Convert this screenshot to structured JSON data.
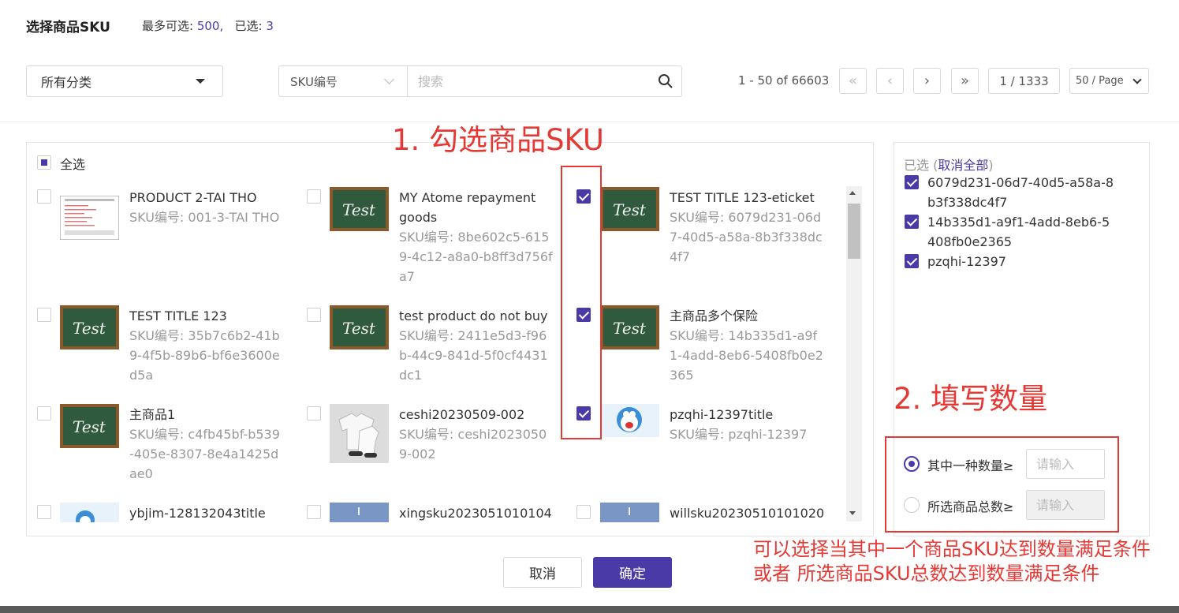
{
  "header": {
    "title": "选择商品SKU",
    "max_label": "最多可选: ",
    "max_value": "500,",
    "selected_label": "已选: ",
    "selected_value": "3"
  },
  "toolbar": {
    "category": "所有分类",
    "search_type": "SKU编号",
    "search_placeholder": "搜索"
  },
  "pagination": {
    "range": "1 - 50 of 66603",
    "first": "«",
    "prev": "‹",
    "next": "›",
    "last": "»",
    "current": "1 / 1333",
    "page_size": "50 / Page"
  },
  "select_all": "全选",
  "products": [
    {
      "name": "PRODUCT 2-TAI THO",
      "sku": "SKU编号: 001-3-TAI THO",
      "thumb": "document",
      "checked": false
    },
    {
      "name": "MY Atome repayment goods",
      "sku": "SKU编号: 8be602c5-6159-4c12-a8a0-b8ff3d756fa7",
      "thumb": "chalkboard",
      "checked": false
    },
    {
      "name": "TEST TITLE 123-eticket",
      "sku": "SKU编号: 6079d231-06d7-40d5-a58a-8b3f338dc4f7",
      "thumb": "chalkboard",
      "checked": true
    },
    {
      "name": "TEST TITLE 123",
      "sku": "SKU编号: 35b7c6b2-41b9-4f5b-89b6-bf6e3600ed5a",
      "thumb": "chalkboard",
      "checked": false
    },
    {
      "name": "test product do not buy",
      "sku": "SKU编号: 2411e5d3-f96b-44c9-841d-5f0cf4431dc1",
      "thumb": "chalkboard",
      "checked": true
    },
    {
      "name": "主商品多个保险",
      "sku": "SKU编号: 14b335d1-a9f1-4add-8eb6-5408fb0e2365",
      "thumb": "chalkboard",
      "checked": false
    },
    {
      "name": "主商品1",
      "sku": "SKU编号: c4fb45bf-b539-405e-8307-8e4a1425dae0",
      "thumb": "chalkboard",
      "checked": false
    },
    {
      "name": "ceshi20230509-002",
      "sku": "SKU编号: ceshi20230509-002",
      "thumb": "clothes",
      "checked": true
    },
    {
      "name": "pzqhi-12397title",
      "sku": "SKU编号: pzqhi-12397",
      "thumb": "cartoon",
      "checked": false
    },
    {
      "name": "ybjim-128132043title",
      "sku": "",
      "thumb": "cartoon",
      "checked": false
    },
    {
      "name": "xingsku2023051010104",
      "sku": "",
      "thumb": "sky",
      "checked": false
    },
    {
      "name": "willsku20230510101020",
      "sku": "",
      "thumb": "sky",
      "checked": false
    }
  ],
  "selected_panel": {
    "label": "已选 (",
    "clear_all": "取消全部",
    "close_paren": ")",
    "items": [
      "6079d231-06d7-40d5-a58a-8b3f338dc4f7",
      "14b335d1-a9f1-4add-8eb6-5408fb0e2365",
      "pzqhi-12397"
    ]
  },
  "quantity": {
    "option1_label": "其中一种数量≥",
    "option2_label": "所选商品总数≥",
    "placeholder": "请输入"
  },
  "annotations": {
    "step1": "1. 勾选商品SKU",
    "step2": "2. 填写数量",
    "note": "可以选择当其中一个商品SKU达到数量满足条件 或者 所选商品SKU总数达到数量满足条件"
  },
  "footer": {
    "cancel": "取消",
    "confirm": "确定"
  },
  "colors": {
    "accent": "#4a3aa8",
    "annotation": "#e53935"
  }
}
